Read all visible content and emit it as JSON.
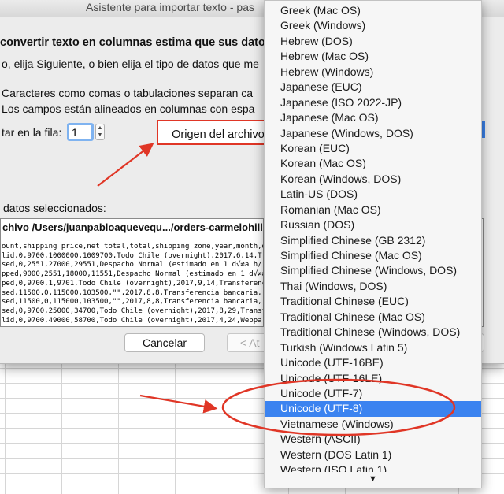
{
  "dialog": {
    "title": "Asistente para importar texto - pas",
    "heading": "convertir texto en columnas estima que sus dato",
    "instruction": "o, elija Siguiente, o bien elija el tipo de datos que me",
    "options": [
      "Caracteres como comas o tabulaciones separan ca",
      "Los campos están alineados en columnas con espa"
    ],
    "start_row_label": "tar en la fila:",
    "start_row_value": "1",
    "file_origin_label": "Origen del archivo",
    "preview_label": "datos seleccionados:",
    "preview_header": "chivo /Users/juanpabloaquevequ.../orders-carmelohill-",
    "preview_lines": [
      "ount,shipping price,net total,total,shipping zone,year,month,d",
      "lid,0,9700,1000000,1009700,Todo Chile (overnight),2017,6,14,T",
      "sed,0,2551,27000,29551,Despacho Normal (estimado en 1 d√≠a h/\"",
      "pped,9000,2551,18000,11551,Despacho Normal (estimado en 1 d√≠a",
      "ped,0,9700,1,9701,Todo Chile (overnight),2017,9,14,Transferenc",
      "sed,11500,0,115000,103500,\"\",2017,8,8,Transferencia bancaria,,",
      "sed,11500,0,115000,103500,\"\",2017,8,8,Transferencia bancaria,,",
      "sed,0,9700,25000,34700,Todo Chile (overnight),2017,8,29,Transf",
      "lid,0,9700,49000,58700,Todo Chile (overnight),2017,4,24,Webpa"
    ],
    "cancel_label": "Cancelar",
    "back_label": "< At"
  },
  "encoding_menu": {
    "selected": "Unicode (UTF-8)",
    "items": [
      "Greek (Mac OS)",
      "Greek (Windows)",
      "Hebrew (DOS)",
      "Hebrew (Mac OS)",
      "Hebrew (Windows)",
      "Japanese (EUC)",
      "Japanese (ISO 2022-JP)",
      "Japanese (Mac OS)",
      "Japanese (Windows, DOS)",
      "Korean (EUC)",
      "Korean (Mac OS)",
      "Korean (Windows, DOS)",
      "Latin-US (DOS)",
      "Romanian (Mac OS)",
      "Russian (DOS)",
      "Simplified Chinese (GB 2312)",
      "Simplified Chinese (Mac OS)",
      "Simplified Chinese (Windows, DOS)",
      "Thai (Windows, DOS)",
      "Traditional Chinese (EUC)",
      "Traditional Chinese (Mac OS)",
      "Traditional Chinese (Windows, DOS)",
      "Turkish (Windows Latin 5)",
      "Unicode (UTF-16BE)",
      "Unicode (UTF-16LE)",
      "Unicode (UTF-7)",
      "Unicode (UTF-8)",
      "Vietnamese (Windows)",
      "Western (ASCII)",
      "Western (DOS Latin 1)",
      "Western (ISO Latin 1)"
    ],
    "scroll_arrow": "▼"
  },
  "colors": {
    "annotation_red": "#e03626",
    "selection_blue": "#3b83f0",
    "focus_ring": "#7fb3f0"
  }
}
